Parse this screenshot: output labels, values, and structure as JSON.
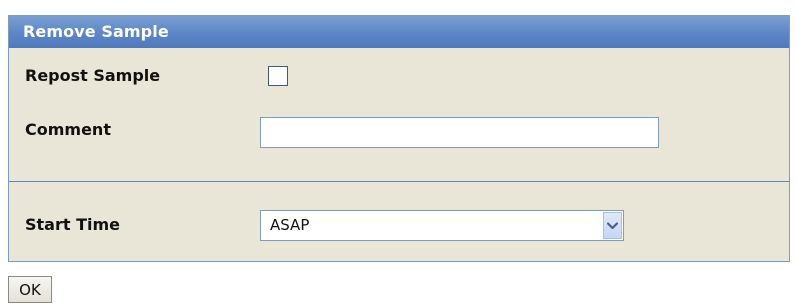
{
  "panel": {
    "title": "Remove Sample"
  },
  "form": {
    "repost_sample": {
      "label": "Repost Sample",
      "checked": false
    },
    "comment": {
      "label": "Comment",
      "value": ""
    },
    "start_time": {
      "label": "Start Time",
      "selected": "ASAP"
    }
  },
  "actions": {
    "ok_label": "OK"
  },
  "icons": {
    "dropdown": "chevron-down-icon"
  },
  "colors": {
    "header_bg": "#5c86c6",
    "panel_bg": "#e9e6d8",
    "border": "#7f9db9"
  }
}
